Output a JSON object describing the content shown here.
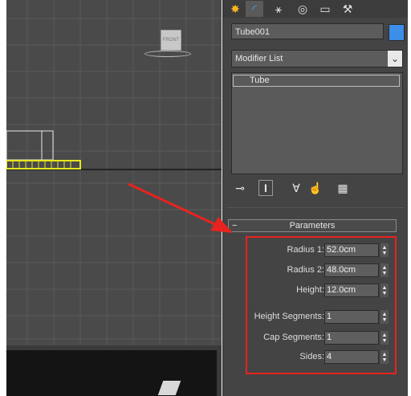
{
  "viewport": {
    "navcube_label": "FRONT"
  },
  "command_panel": {
    "tabs": [
      {
        "name": "create-tab",
        "icon": "sun-star-icon",
        "glyph": "✸",
        "color": "#f5b41e"
      },
      {
        "name": "modify-tab",
        "icon": "modify-arc-icon",
        "glyph": "◜",
        "color": "#4fa8ff"
      },
      {
        "name": "hierarchy-tab",
        "icon": "hierarchy-icon",
        "glyph": "⚹",
        "color": "#e0e0e0"
      },
      {
        "name": "motion-tab",
        "icon": "motion-icon",
        "glyph": "◎",
        "color": "#e0e0e0"
      },
      {
        "name": "display-tab",
        "icon": "display-monitor-icon",
        "glyph": "▭",
        "color": "#e0e0e0"
      },
      {
        "name": "utilities-tab",
        "icon": "hammer-icon",
        "glyph": "⚒",
        "color": "#e0e0e0"
      }
    ],
    "object_name": "Tube001",
    "object_color": "#3d8ee8",
    "modifier_list": "Modifier List",
    "modifier_stack": [
      "Tube"
    ],
    "stack_tools": [
      {
        "name": "pin-stack-icon",
        "glyph": "⊸"
      },
      {
        "name": "show-end-result-icon",
        "glyph": "I"
      },
      {
        "name": "make-unique-icon",
        "glyph": "∀"
      },
      {
        "name": "remove-modifier-icon",
        "glyph": "☝"
      },
      {
        "name": "configure-sets-icon",
        "glyph": "▦"
      }
    ],
    "parameters": {
      "title": "Parameters",
      "collapse": "−",
      "rows": [
        {
          "label": "Radius 1:",
          "value": "52.0cm"
        },
        {
          "label": "Radius 2:",
          "value": "48.0cm"
        },
        {
          "label": "Height:",
          "value": "12.0cm"
        },
        {
          "label": "Height Segments:",
          "value": "1"
        },
        {
          "label": "Cap Segments:",
          "value": "1"
        },
        {
          "label": "Sides:",
          "value": "4"
        }
      ]
    }
  },
  "annotation": {
    "color": "#e8231f"
  }
}
